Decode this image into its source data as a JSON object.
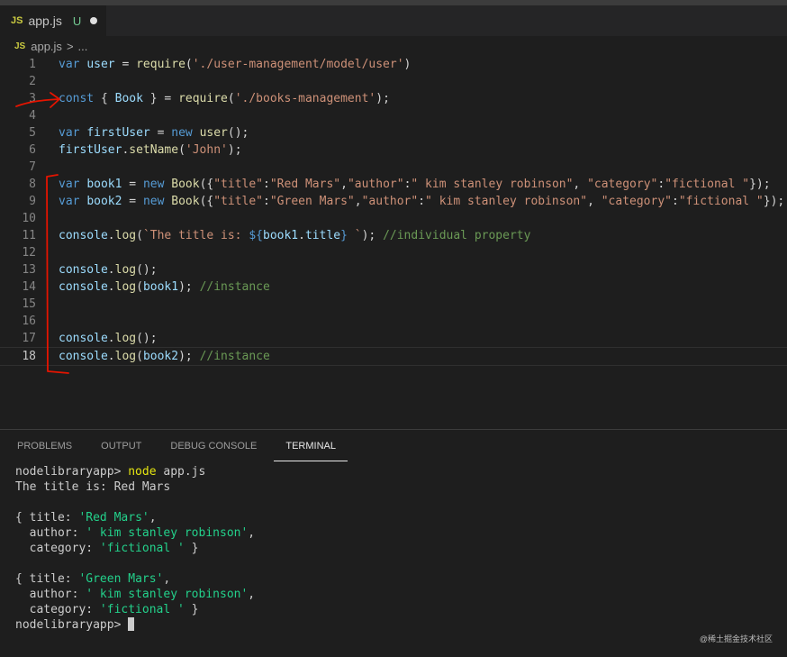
{
  "tab": {
    "icon": "JS",
    "filename": "app.js",
    "status": "U"
  },
  "breadcrumb": {
    "icon": "JS",
    "file": "app.js",
    "separator": ">",
    "more": "..."
  },
  "editor": {
    "lines": [
      {
        "num": "1",
        "tokens": [
          [
            "k",
            "var "
          ],
          [
            "v",
            "user"
          ],
          [
            "p",
            " = "
          ],
          [
            "f",
            "require"
          ],
          [
            "p",
            "("
          ],
          [
            "s",
            "'./user-management/model/user'"
          ],
          [
            "p",
            ")"
          ]
        ]
      },
      {
        "num": "2",
        "tokens": []
      },
      {
        "num": "3",
        "tokens": [
          [
            "k",
            "const"
          ],
          [
            "p",
            " { "
          ],
          [
            "v",
            "Book"
          ],
          [
            "p",
            " } = "
          ],
          [
            "f",
            "require"
          ],
          [
            "p",
            "("
          ],
          [
            "s",
            "'./books-management'"
          ],
          [
            "p",
            ");"
          ]
        ]
      },
      {
        "num": "4",
        "tokens": []
      },
      {
        "num": "5",
        "tokens": [
          [
            "k",
            "var "
          ],
          [
            "v",
            "firstUser"
          ],
          [
            "p",
            " = "
          ],
          [
            "k",
            "new "
          ],
          [
            "f",
            "user"
          ],
          [
            "p",
            "();"
          ]
        ]
      },
      {
        "num": "6",
        "tokens": [
          [
            "v",
            "firstUser"
          ],
          [
            "p",
            "."
          ],
          [
            "f",
            "setName"
          ],
          [
            "p",
            "("
          ],
          [
            "s",
            "'John'"
          ],
          [
            "p",
            ");"
          ]
        ]
      },
      {
        "num": "7",
        "tokens": []
      },
      {
        "num": "8",
        "tokens": [
          [
            "k",
            "var "
          ],
          [
            "v",
            "book1"
          ],
          [
            "p",
            " = "
          ],
          [
            "k",
            "new "
          ],
          [
            "f",
            "Book"
          ],
          [
            "p",
            "({"
          ],
          [
            "s",
            "\"title\""
          ],
          [
            "p",
            ":"
          ],
          [
            "s",
            "\"Red Mars\""
          ],
          [
            "p",
            ","
          ],
          [
            "s",
            "\"author\""
          ],
          [
            "p",
            ":"
          ],
          [
            "s",
            "\" kim stanley robinson\""
          ],
          [
            "p",
            ", "
          ],
          [
            "s",
            "\"category\""
          ],
          [
            "p",
            ":"
          ],
          [
            "s",
            "\"fictional \""
          ],
          [
            "p",
            "});"
          ]
        ]
      },
      {
        "num": "9",
        "tokens": [
          [
            "k",
            "var "
          ],
          [
            "v",
            "book2"
          ],
          [
            "p",
            " = "
          ],
          [
            "k",
            "new "
          ],
          [
            "f",
            "Book"
          ],
          [
            "p",
            "({"
          ],
          [
            "s",
            "\"title\""
          ],
          [
            "p",
            ":"
          ],
          [
            "s",
            "\"Green Mars\""
          ],
          [
            "p",
            ","
          ],
          [
            "s",
            "\"author\""
          ],
          [
            "p",
            ":"
          ],
          [
            "s",
            "\" kim stanley robinson\""
          ],
          [
            "p",
            ", "
          ],
          [
            "s",
            "\"category\""
          ],
          [
            "p",
            ":"
          ],
          [
            "s",
            "\"fictional \""
          ],
          [
            "p",
            "});"
          ]
        ]
      },
      {
        "num": "10",
        "tokens": []
      },
      {
        "num": "11",
        "tokens": [
          [
            "v",
            "console"
          ],
          [
            "p",
            "."
          ],
          [
            "f",
            "log"
          ],
          [
            "p",
            "("
          ],
          [
            "s",
            "`The title is: "
          ],
          [
            "k",
            "${"
          ],
          [
            "v",
            "book1"
          ],
          [
            "p",
            "."
          ],
          [
            "v",
            "title"
          ],
          [
            "k",
            "}"
          ],
          [
            "s",
            " `"
          ],
          [
            "p",
            "); "
          ],
          [
            "c",
            "//individual property"
          ]
        ]
      },
      {
        "num": "12",
        "tokens": []
      },
      {
        "num": "13",
        "tokens": [
          [
            "v",
            "console"
          ],
          [
            "p",
            "."
          ],
          [
            "f",
            "log"
          ],
          [
            "p",
            "();"
          ]
        ]
      },
      {
        "num": "14",
        "tokens": [
          [
            "v",
            "console"
          ],
          [
            "p",
            "."
          ],
          [
            "f",
            "log"
          ],
          [
            "p",
            "("
          ],
          [
            "v",
            "book1"
          ],
          [
            "p",
            "); "
          ],
          [
            "c",
            "//instance"
          ]
        ]
      },
      {
        "num": "15",
        "tokens": []
      },
      {
        "num": "16",
        "tokens": []
      },
      {
        "num": "17",
        "tokens": [
          [
            "v",
            "console"
          ],
          [
            "p",
            "."
          ],
          [
            "f",
            "log"
          ],
          [
            "p",
            "();"
          ]
        ]
      },
      {
        "num": "18",
        "tokens": [
          [
            "v",
            "console"
          ],
          [
            "p",
            "."
          ],
          [
            "f",
            "log"
          ],
          [
            "p",
            "("
          ],
          [
            "v",
            "book2"
          ],
          [
            "p",
            "); "
          ],
          [
            "c",
            "//instance"
          ]
        ]
      }
    ],
    "active_line": "18"
  },
  "panel": {
    "tabs": [
      "PROBLEMS",
      "OUTPUT",
      "DEBUG CONSOLE",
      "TERMINAL"
    ],
    "active_tab": "TERMINAL"
  },
  "terminal": {
    "lines": [
      [
        [
          "p",
          "nodelibraryapp> "
        ],
        [
          "ty",
          "node"
        ],
        [
          "p",
          " app.js"
        ]
      ],
      [
        [
          "p",
          "The title is: Red Mars"
        ]
      ],
      [
        [
          "p",
          ""
        ]
      ],
      [
        [
          "p",
          "{ title: "
        ],
        [
          "tg",
          "'Red Mars'"
        ],
        [
          "p",
          ","
        ]
      ],
      [
        [
          "p",
          "  author: "
        ],
        [
          "tg",
          "' kim stanley robinson'"
        ],
        [
          "p",
          ","
        ]
      ],
      [
        [
          "p",
          "  category: "
        ],
        [
          "tg",
          "'fictional '"
        ],
        [
          "p",
          " }"
        ]
      ],
      [
        [
          "p",
          ""
        ]
      ],
      [
        [
          "p",
          "{ title: "
        ],
        [
          "tg",
          "'Green Mars'"
        ],
        [
          "p",
          ","
        ]
      ],
      [
        [
          "p",
          "  author: "
        ],
        [
          "tg",
          "' kim stanley robinson'"
        ],
        [
          "p",
          ","
        ]
      ],
      [
        [
          "p",
          "  category: "
        ],
        [
          "tg",
          "'fictional '"
        ],
        [
          "p",
          " }"
        ]
      ]
    ],
    "prompt": "nodelibraryapp> "
  },
  "watermark": "@稀土掘金技术社区",
  "colors": {
    "keyword": "#569cd6",
    "variable": "#9cdcfe",
    "function": "#dcdcaa",
    "string": "#ce9178",
    "comment": "#6a9955",
    "annotation": "#e51400"
  }
}
